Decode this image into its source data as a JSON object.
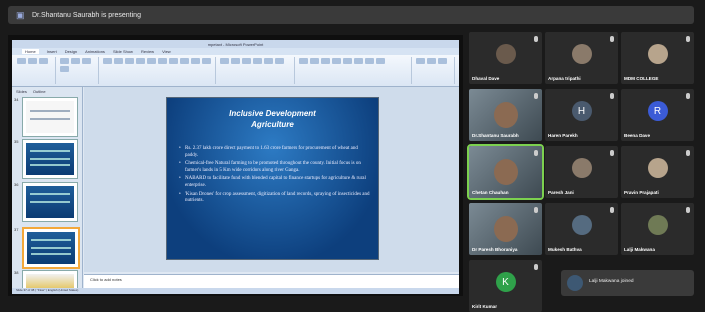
{
  "topbar": {
    "presenter_text": "Dr.Shantanu Saurabh is presenting"
  },
  "ppt": {
    "window_title": "mpetaxt - Microsoft PowerPoint",
    "tabs": [
      "Home",
      "Insert",
      "Design",
      "Animations",
      "Slide Show",
      "Review",
      "View"
    ],
    "panel_tabs": [
      "Slides",
      "Outline"
    ],
    "notes_placeholder": "Click to add notes",
    "status_text": "Slide 37 of 38 | \"Flow\" | English (United States)",
    "thumb_numbers": [
      "34",
      "35",
      "36",
      "37",
      "38"
    ]
  },
  "slide": {
    "title_line1": "Inclusive Development",
    "title_line2": "Agriculture",
    "bullets": [
      "Rs. 2.37 lakh crore direct payment to 1.63 crore farmers for procurement of wheat and paddy.",
      "Chemical-free Natural farming to be promoted throughout the county. Initial focus is on farmer's lands in 5 Km wide corridors along river Ganga.",
      "NABARD to facilitate fund with blended capital to finance startups for agriculture & rural enterprise.",
      "'Kisan Drones' for crop assessment, digitization of land records, spraying of insecticides and nutrients."
    ]
  },
  "participants": [
    {
      "name": "Dhaval Dave",
      "type": "photo"
    },
    {
      "name": "Arpana tripathi",
      "type": "photo"
    },
    {
      "name": "MDM COLLEGE",
      "type": "photo"
    },
    {
      "name": "Dr.Shantanu Saurabh",
      "type": "video"
    },
    {
      "name": "Haren Parekh",
      "type": "letter",
      "letter": "H",
      "color": "#4a5a6e"
    },
    {
      "name": "Beena Dave",
      "type": "letter",
      "letter": "R",
      "color": "#3b5bd6"
    },
    {
      "name": "Chetan Chauhan",
      "type": "video"
    },
    {
      "name": "Paresh Jani",
      "type": "photo"
    },
    {
      "name": "Pravin Prajapati",
      "type": "photo"
    },
    {
      "name": "Dr Paresh Bhoraniya",
      "type": "video"
    },
    {
      "name": "Mukesh Bathva",
      "type": "photo"
    },
    {
      "name": "Lalji Makwana",
      "type": "photo"
    },
    {
      "name": "Kirit Kumar",
      "type": "letter",
      "letter": "K",
      "color": "#2fa14a"
    }
  ],
  "toast": {
    "text": "Lalji Makwana joined"
  }
}
